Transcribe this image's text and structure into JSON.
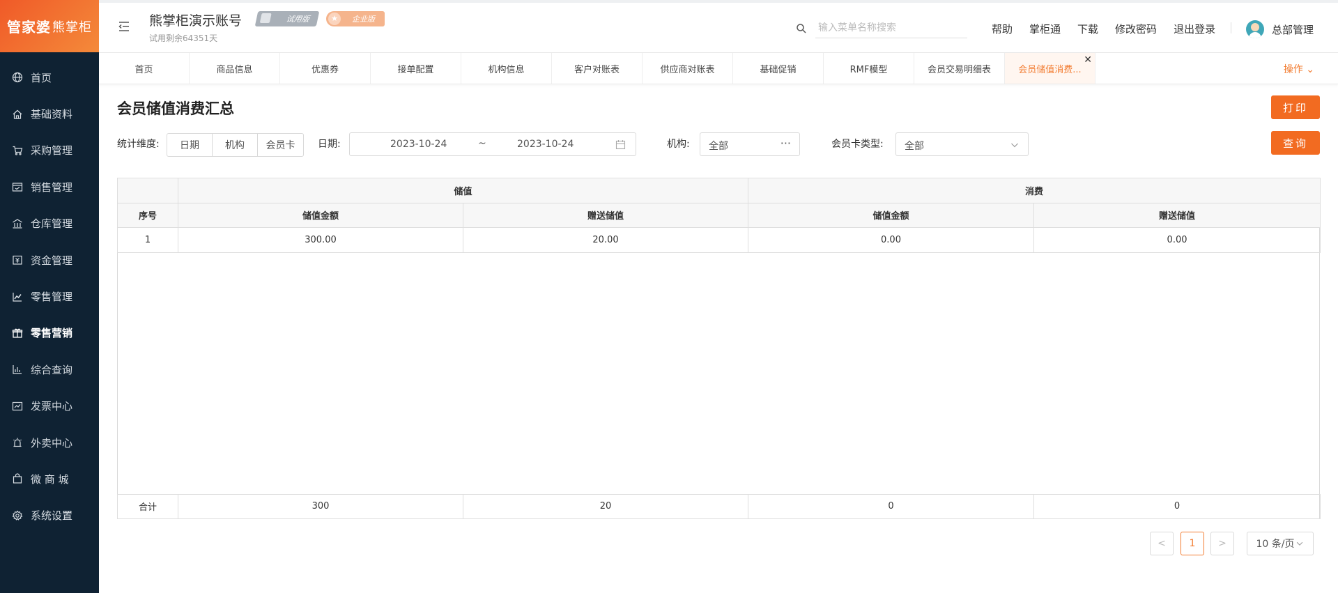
{
  "brand": {
    "logo_main": "管家婆",
    "logo_sub": "熊掌柜"
  },
  "sidebar": {
    "items": [
      {
        "label": "首页",
        "icon": "globe-icon"
      },
      {
        "label": "基础资料",
        "icon": "home-icon"
      },
      {
        "label": "采购管理",
        "icon": "cart-icon"
      },
      {
        "label": "销售管理",
        "icon": "sales-icon"
      },
      {
        "label": "仓库管理",
        "icon": "warehouse-icon"
      },
      {
        "label": "资金管理",
        "icon": "fund-icon"
      },
      {
        "label": "零售管理",
        "icon": "chart-icon"
      },
      {
        "label": "零售营销",
        "icon": "gift-icon",
        "active": true
      },
      {
        "label": "综合查询",
        "icon": "bar-chart-icon"
      },
      {
        "label": "发票中心",
        "icon": "invoice-icon"
      },
      {
        "label": "外卖中心",
        "icon": "alarm-icon"
      },
      {
        "label": "微 商 城",
        "icon": "bag-icon"
      },
      {
        "label": "系统设置",
        "icon": "gear-icon"
      }
    ]
  },
  "header": {
    "account_name": "熊掌柜演示账号",
    "badge_trial": "试用版",
    "badge_enterprise": "企业版",
    "trial_days": "试用剩余64351天",
    "search_placeholder": "输入菜单名称搜索",
    "links": {
      "help": "帮助",
      "zhangguitong": "掌柜通",
      "download": "下载",
      "change_password": "修改密码",
      "logout": "退出登录"
    },
    "user_name": "总部管理"
  },
  "tabs": {
    "items": [
      "首页",
      "商品信息",
      "优惠券",
      "接单配置",
      "机构信息",
      "客户对账表",
      "供应商对账表",
      "基础促销",
      "RMF模型",
      "会员交易明细表",
      "会员储值消费..."
    ],
    "active_index": 10,
    "actions_label": "操作 ⌄"
  },
  "page": {
    "title": "会员储值消费汇总",
    "print_button": "打印",
    "query_button": "查询"
  },
  "filters": {
    "dimension_label": "统计维度:",
    "dimension_options": [
      "日期",
      "机构",
      "会员卡"
    ],
    "date_label": "日期:",
    "date_start": "2023-10-24",
    "date_sep": "~",
    "date_end": "2023-10-24",
    "org_label": "机构:",
    "org_value": "全部",
    "org_more": "···",
    "card_type_label": "会员卡类型:",
    "card_type_value": "全部"
  },
  "table": {
    "group_headers": {
      "stored": "储值",
      "consume": "消费"
    },
    "columns": [
      "序号",
      "储值金额",
      "赠送储值",
      "储值金额",
      "赠送储值"
    ],
    "rows": [
      [
        "1",
        "300.00",
        "20.00",
        "0.00",
        "0.00"
      ]
    ],
    "footer": [
      "合计",
      "300",
      "20",
      "0",
      "0"
    ]
  },
  "pagination": {
    "prev": "<",
    "current": "1",
    "next": ">",
    "page_size": "10 条/页"
  },
  "colors": {
    "accent": "#f26b21",
    "sidebar_bg": "#0f2233"
  }
}
